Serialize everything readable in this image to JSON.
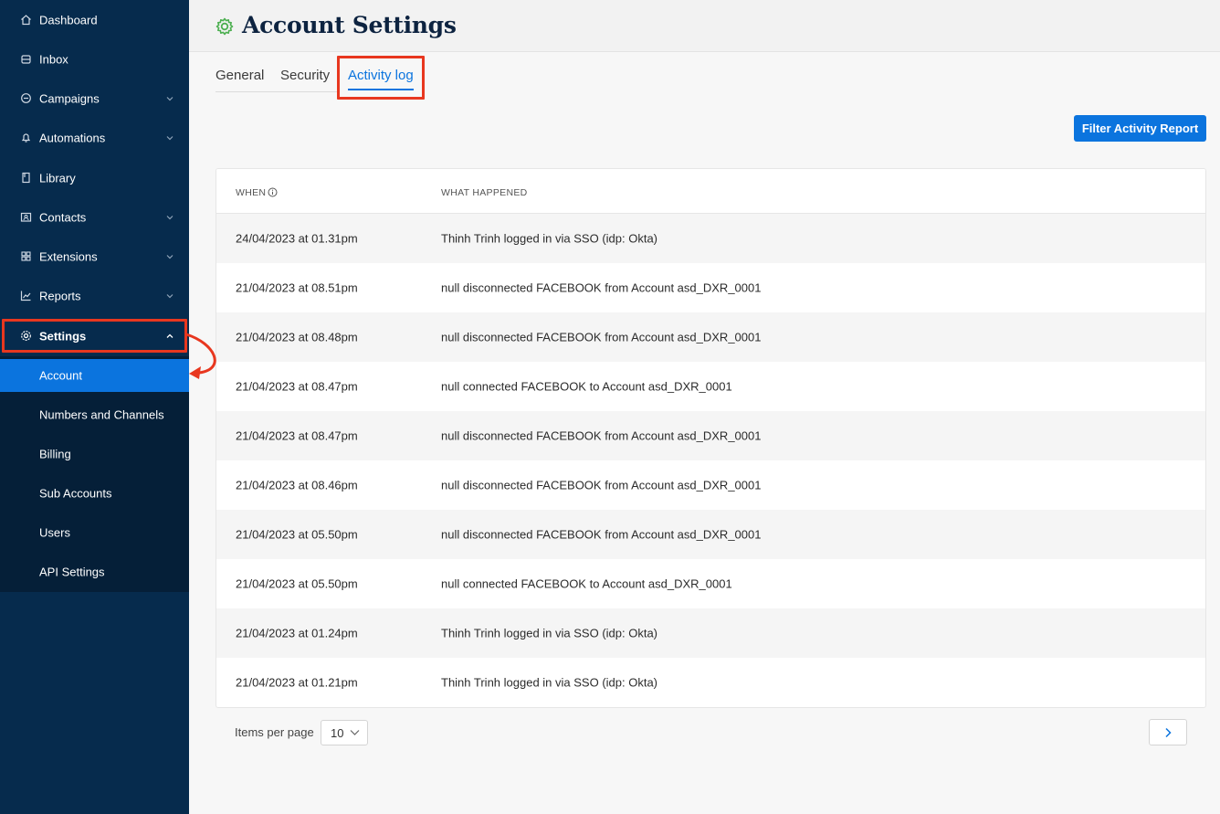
{
  "sidebar": {
    "items": [
      {
        "label": "Dashboard",
        "icon": "home-icon"
      },
      {
        "label": "Inbox",
        "icon": "inbox-icon"
      },
      {
        "label": "Campaigns",
        "icon": "campaigns-icon"
      },
      {
        "label": "Automations",
        "icon": "bell-icon"
      },
      {
        "label": "Library",
        "icon": "book-icon"
      },
      {
        "label": "Contacts",
        "icon": "contacts-icon"
      },
      {
        "label": "Extensions",
        "icon": "grid-icon"
      },
      {
        "label": "Reports",
        "icon": "chart-icon"
      },
      {
        "label": "Settings",
        "icon": "gear-icon"
      }
    ],
    "settings_sub": [
      {
        "label": "Account",
        "active": true
      },
      {
        "label": "Numbers and Channels"
      },
      {
        "label": "Billing"
      },
      {
        "label": "Sub Accounts"
      },
      {
        "label": "Users"
      },
      {
        "label": "API Settings"
      }
    ]
  },
  "header": {
    "title": "Account Settings",
    "icon": "gear-icon"
  },
  "tabs": [
    {
      "label": "General"
    },
    {
      "label": "Security"
    },
    {
      "label": "Activity log",
      "active": true
    }
  ],
  "toolbar": {
    "filter_label": "Filter Activity Report"
  },
  "table": {
    "columns": [
      "WHEN",
      "WHAT HAPPENED"
    ],
    "rows": [
      {
        "when": "24/04/2023 at 01.31pm",
        "what": "Thinh Trinh logged in via SSO (idp: Okta)"
      },
      {
        "when": "21/04/2023 at 08.51pm",
        "what": "null disconnected FACEBOOK from Account asd_DXR_0001"
      },
      {
        "when": "21/04/2023 at 08.48pm",
        "what": "null disconnected FACEBOOK from Account asd_DXR_0001"
      },
      {
        "when": "21/04/2023 at 08.47pm",
        "what": "null connected FACEBOOK to Account asd_DXR_0001"
      },
      {
        "when": "21/04/2023 at 08.47pm",
        "what": "null disconnected FACEBOOK from Account asd_DXR_0001"
      },
      {
        "when": "21/04/2023 at 08.46pm",
        "what": "null disconnected FACEBOOK from Account asd_DXR_0001"
      },
      {
        "when": "21/04/2023 at 05.50pm",
        "what": "null disconnected FACEBOOK from Account asd_DXR_0001"
      },
      {
        "when": "21/04/2023 at 05.50pm",
        "what": "null connected FACEBOOK to Account asd_DXR_0001"
      },
      {
        "when": "21/04/2023 at 01.24pm",
        "what": "Thinh Trinh logged in via SSO (idp: Okta)"
      },
      {
        "when": "21/04/2023 at 01.21pm",
        "what": "Thinh Trinh logged in via SSO (idp: Okta)"
      }
    ]
  },
  "pagination": {
    "items_per_page_label": "Items per page",
    "items_per_page": "10"
  },
  "colors": {
    "sidebar": "#062b4d",
    "submenu": "#051f38",
    "accent": "#0b74de",
    "highlight": "#e8371f",
    "gear": "#4caf50"
  }
}
